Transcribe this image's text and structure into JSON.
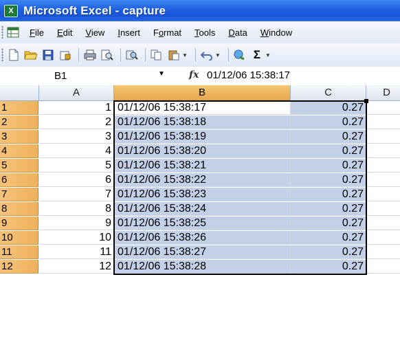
{
  "window": {
    "title": "Microsoft Excel - capture",
    "app_icon_label": "X"
  },
  "menu": {
    "items": [
      {
        "label": "File",
        "accel": "F",
        "rest": "ile"
      },
      {
        "label": "Edit",
        "accel": "E",
        "rest": "dit"
      },
      {
        "label": "View",
        "accel": "V",
        "rest": "iew"
      },
      {
        "label": "Insert",
        "accel": "I",
        "rest": "nsert"
      },
      {
        "label": "Format",
        "accel": "o",
        "pre": "F",
        "rest": "rmat"
      },
      {
        "label": "Tools",
        "accel": "T",
        "rest": "ools"
      },
      {
        "label": "Data",
        "accel": "D",
        "rest": "ata"
      },
      {
        "label": "Window",
        "accel": "W",
        "rest": "indow"
      }
    ]
  },
  "toolbar": {
    "buttons": [
      "new-icon",
      "open-icon",
      "save-icon",
      "permission-icon",
      "print-icon",
      "print-preview-icon",
      "research-icon",
      "copy-icon",
      "paste-icon",
      "undo-icon",
      "hyperlink-icon",
      "autosum-icon"
    ],
    "sigma": "Σ",
    "drop": "▼"
  },
  "formula_bar": {
    "name_box": "B1",
    "fx": "fx",
    "value": "01/12/06 15:38:17"
  },
  "columns": [
    "A",
    "B",
    "C",
    "D"
  ],
  "selected_column": "B",
  "rows": [
    {
      "n": "1",
      "a": "1",
      "b": "01/12/06 15:38:17",
      "c": "0.27"
    },
    {
      "n": "2",
      "a": "2",
      "b": "01/12/06 15:38:18",
      "c": "0.27"
    },
    {
      "n": "3",
      "a": "3",
      "b": "01/12/06 15:38:19",
      "c": "0.27"
    },
    {
      "n": "4",
      "a": "4",
      "b": "01/12/06 15:38:20",
      "c": "0.27"
    },
    {
      "n": "5",
      "a": "5",
      "b": "01/12/06 15:38:21",
      "c": "0.27"
    },
    {
      "n": "6",
      "a": "6",
      "b": "01/12/06 15:38:22",
      "c": "0.27"
    },
    {
      "n": "7",
      "a": "7",
      "b": "01/12/06 15:38:23",
      "c": "0.27"
    },
    {
      "n": "8",
      "a": "8",
      "b": "01/12/06 15:38:24",
      "c": "0.27"
    },
    {
      "n": "9",
      "a": "9",
      "b": "01/12/06 15:38:25",
      "c": "0.27"
    },
    {
      "n": "10",
      "a": "10",
      "b": "01/12/06 15:38:26",
      "c": "0.27"
    },
    {
      "n": "11",
      "a": "11",
      "b": "01/12/06 15:38:27",
      "c": "0.27"
    },
    {
      "n": "12",
      "a": "12",
      "b": "01/12/06 15:38:28",
      "c": "0.27"
    }
  ],
  "colors": {
    "title_bar": "#1f5fe0",
    "selection": "#c3d0e8",
    "header_selected": "#e8a54a"
  }
}
